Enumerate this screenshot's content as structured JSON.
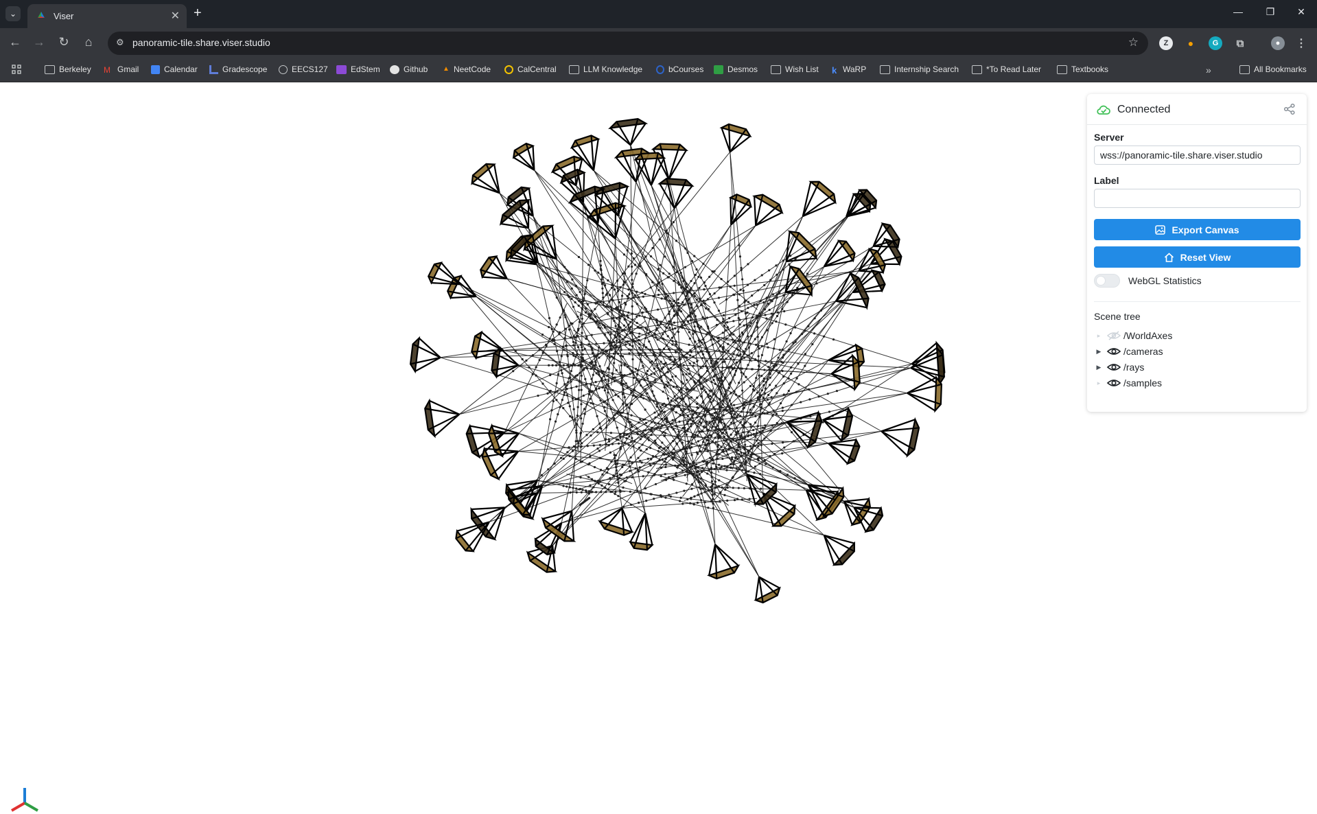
{
  "browser": {
    "tab_title": "Viser",
    "url": "panoramic-tile.share.viser.studio",
    "bookmarks": [
      {
        "label": "Berkeley",
        "icon": "folder-icon"
      },
      {
        "label": "Gmail",
        "icon": "gmail-icon"
      },
      {
        "label": "Calendar",
        "icon": "calendar-icon"
      },
      {
        "label": "Gradescope",
        "icon": "gradescope-icon"
      },
      {
        "label": "EECS127",
        "icon": "globe-icon"
      },
      {
        "label": "EdStem",
        "icon": "edstem-icon"
      },
      {
        "label": "Github",
        "icon": "github-icon"
      },
      {
        "label": "NeetCode",
        "icon": "neetcode-icon"
      },
      {
        "label": "CalCentral",
        "icon": "calcentral-icon"
      },
      {
        "label": "LLM Knowledge",
        "icon": "folder-icon"
      },
      {
        "label": "bCourses",
        "icon": "bcourses-icon"
      },
      {
        "label": "Desmos",
        "icon": "desmos-icon"
      },
      {
        "label": "Wish List",
        "icon": "folder-icon"
      },
      {
        "label": "WaRP",
        "icon": "warp-icon"
      },
      {
        "label": "Internship Search",
        "icon": "folder-icon"
      },
      {
        "label": "*To Read Later",
        "icon": "folder-icon"
      },
      {
        "label": "Textbooks",
        "icon": "folder-icon"
      }
    ],
    "all_bookmarks": "All Bookmarks"
  },
  "panel": {
    "status": "Connected",
    "server_label": "Server",
    "server_value": "wss://panoramic-tile.share.viser.studio",
    "label_label": "Label",
    "label_value": "",
    "export_button": "Export Canvas",
    "reset_button": "Reset View",
    "webgl_label": "WebGL Statistics",
    "webgl_enabled": false,
    "scene_tree_title": "Scene tree",
    "scene_tree": [
      {
        "label": "/WorldAxes",
        "visible": false,
        "expandable": false
      },
      {
        "label": "/cameras",
        "visible": true,
        "expandable": true
      },
      {
        "label": "/rays",
        "visible": true,
        "expandable": true
      },
      {
        "label": "/samples",
        "visible": true,
        "expandable": false
      }
    ]
  },
  "colors": {
    "accent": "#228be6",
    "connected": "#40c057",
    "chrome_dark": "#1f2329",
    "chrome_toolbar": "#35373c"
  }
}
